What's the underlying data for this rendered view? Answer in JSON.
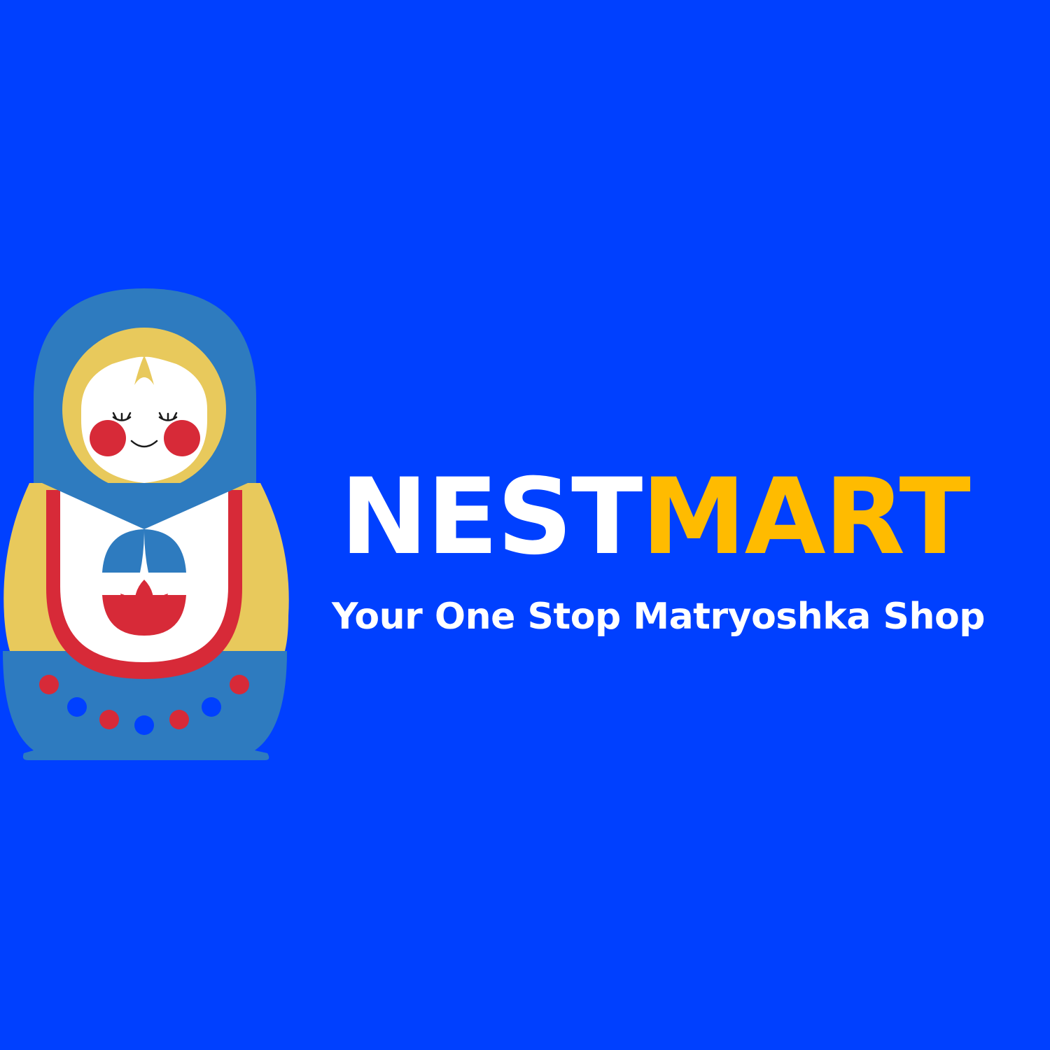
{
  "brand": {
    "name_part1": "NEST",
    "name_part2": "MART",
    "tagline": "Your One Stop Matryoshka Shop"
  },
  "logo": {
    "icon": "matryoshka-doll-icon"
  },
  "colors": {
    "background": "#0040FF",
    "name_part1": "#FFFFFF",
    "name_part2": "#FFBB00",
    "tagline": "#FFFFFF",
    "doll_scarf": "#2E7BBF",
    "doll_hair": "#E8C95C",
    "doll_apron_red": "#D72A38",
    "doll_face": "#FFFFFF",
    "doll_dot_blue": "#0040FF"
  }
}
